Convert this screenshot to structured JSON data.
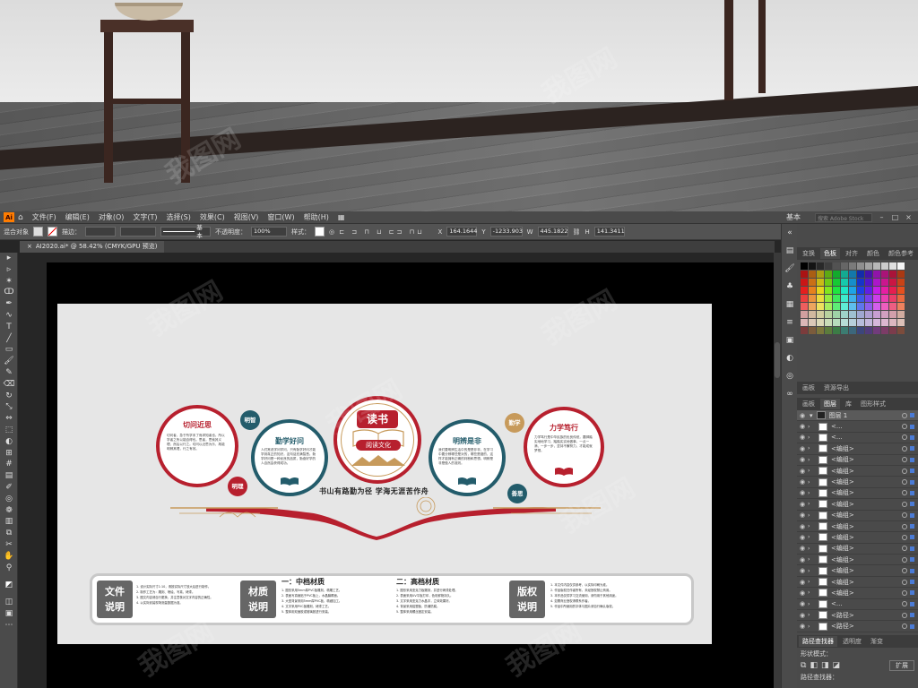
{
  "menubar": {
    "app_logo": "Ai",
    "menus": [
      "文件(F)",
      "编辑(E)",
      "对象(O)",
      "文字(T)",
      "选择(S)",
      "效果(C)",
      "视图(V)",
      "窗口(W)",
      "帮助(H)"
    ],
    "layout_label": "基本",
    "search_placeholder": "搜索 Adobe Stock"
  },
  "control": {
    "no_selection": "混合对象",
    "stroke_label": "描边：",
    "stroke_style": "基本",
    "opacity_label": "不透明度：",
    "opacity_value": "100%",
    "style_label": "样式：",
    "x_value": "164.1644",
    "y_value": "-1233.903",
    "w_value": "445.1822",
    "h_value": "141.3411"
  },
  "document": {
    "tab_label": "AI2020.ai* @ 58.42% (CMYK/GPU 预览)"
  },
  "panels": {
    "top_tabs": [
      "变换",
      "色板",
      "对齐",
      "颜色",
      "颜色参考"
    ],
    "top_active": "色板",
    "small_tabs": [
      "画板",
      "资源导出"
    ],
    "layers_tabs": [
      "图层",
      "库",
      "图形样式"
    ],
    "layers_active": "图层",
    "top_layer": "图层 1",
    "layers": [
      "<...",
      "<...",
      "<编组>",
      "<编组>",
      "<编组>",
      "<编组>",
      "<编组>",
      "<编组>",
      "<编组>",
      "<编组>",
      "<编组>",
      "<编组>",
      "<编组>",
      "<编组>",
      "<编组>",
      "<编组>",
      "<...",
      "<路径>",
      "<路径>"
    ],
    "pathfinder_tabs": [
      "路径查找器",
      "透明度",
      "渐变"
    ],
    "pathfinder_active": "路径查找器",
    "shape_modes_label": "形状模式：",
    "pathfinders_label": "路径查找器：",
    "expand_label": "扩展"
  },
  "design": {
    "center_title": "读书",
    "center_subtitle": "阅读文化",
    "slogan": "书山有路勤为径  学海无涯苦作舟",
    "circles": [
      {
        "title": "切问近思",
        "color": "#b7202e",
        "body": "切问者，急于所学未了而求知者也。所以学者之所以能自得也。思者，思索其义理，然后以行之。切问以近思为乐，故能明辨其理，行之有效。"
      },
      {
        "title": "勤学好问",
        "color": "#235c6b",
        "body": "人们常说学问学问，只有勤学好问才能学到真正的知识，这句话充满智慧。勤学好问是一种优良的品质，勤奋好学的人自然会获得成功。"
      },
      {
        "title": "明辨是非",
        "color": "#235c6b",
        "body": "我们要明辨生活中的是是非非，在学习中要分辨哪些是对的，哪些是错的，这样才能拥有正确的判断和思想。明辨是非是做人的准则。"
      },
      {
        "title": "力学笃行",
        "color": "#b7202e",
        "body": "力学笃行是中华民族的优良传统，要脚踏实地地学习，踏踏实实地做事，一点一滴、一步一步，坚持不懈努力，才能成就梦想。"
      }
    ],
    "badges": [
      {
        "label": "明智",
        "color": "#235c6b"
      },
      {
        "label": "明理",
        "color": "#b7202e"
      },
      {
        "label": "勤学",
        "color": "#c79a5b"
      },
      {
        "label": "善思",
        "color": "#235c6b"
      }
    ],
    "info": {
      "file_title_1": "文件",
      "file_title_2": "说明",
      "material_title_1": "材质",
      "material_title_2": "说明",
      "copyright_title_1": "版权",
      "copyright_title_2": "说明",
      "mid_title": "一：中档材质",
      "high_title": "二：高档材质",
      "file_lines": [
        "1. 设计实际尺寸1:10，请按实际尺寸放大后进行制作。",
        "2. 制作工艺为：雕刻、喷绘、写真、烤漆。",
        "3. 图文内容请自行更换，并注意核对文字内容的正确性。",
        "4. 以实际安装现场测量数据为准。"
      ],
      "mid_lines": [
        "1. 图形采用5mm厚PVC板雕刻，精雕工艺。",
        "2. 表面写真裱贴于PVC板上，水晶膜覆面。",
        "3. 大型背景采用5mm厚PVC板，精细加工。",
        "4. 文字采用PVC板雕刻，烤漆工艺。",
        "5. 整体用双面胶或玻璃胶进行安装。"
      ],
      "high_lines": [
        "1. 图形采用亚克力板雕刻，并进行烤漆处理。",
        "2. 表面采用UV平板打印，色彩鲜艳持久。",
        "3. 文字采用亚克力水晶字，立体效果好。",
        "4. 背景采用铝塑板，防潮防腐。",
        "5. 整体采用螺丝固定安装。"
      ],
      "copyright_lines": [
        "1. 本文件内容仅供参考，以实际印刷为准。",
        "2. 作品版权归作者所有，未经授权禁止商用。",
        "3. 本作品仅供学习交流使用，请勿用于其他用途。",
        "4. 如需商业授权请联系作者。",
        "5. 作品中所使用的字体与图片请自行确认版权。"
      ]
    }
  },
  "watermark": "我图网",
  "colors": {
    "red": "#b7202e",
    "teal": "#235c6b",
    "gold": "#c79a5b"
  }
}
